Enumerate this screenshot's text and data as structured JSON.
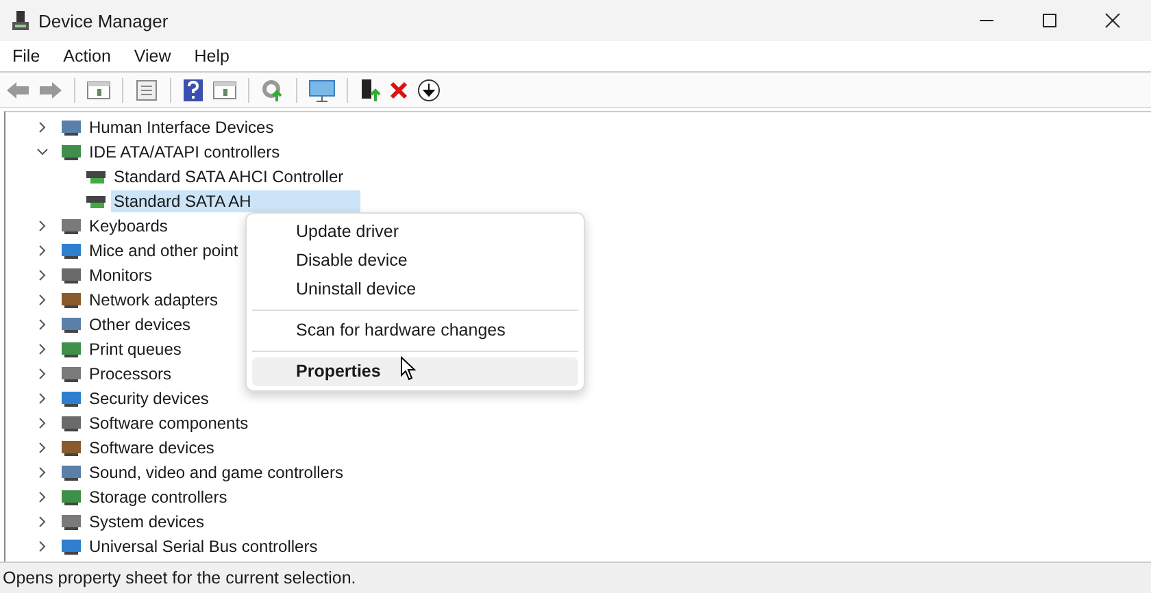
{
  "window": {
    "title": "Device Manager"
  },
  "menu_bar": [
    "File",
    "Action",
    "View",
    "Help"
  ],
  "tree": [
    {
      "label": "Human Interface Devices",
      "expanded": false
    },
    {
      "label": "IDE ATA/ATAPI controllers",
      "expanded": true,
      "children": [
        {
          "label": "Standard SATA AHCI Controller",
          "selected": false
        },
        {
          "label": "Standard SATA AH",
          "selected": true
        }
      ]
    },
    {
      "label": "Keyboards",
      "expanded": false
    },
    {
      "label": "Mice and other point",
      "expanded": false
    },
    {
      "label": "Monitors",
      "expanded": false
    },
    {
      "label": "Network adapters",
      "expanded": false
    },
    {
      "label": "Other devices",
      "expanded": false
    },
    {
      "label": "Print queues",
      "expanded": false
    },
    {
      "label": "Processors",
      "expanded": false
    },
    {
      "label": "Security devices",
      "expanded": false
    },
    {
      "label": "Software components",
      "expanded": false
    },
    {
      "label": "Software devices",
      "expanded": false
    },
    {
      "label": "Sound, video and game controllers",
      "expanded": false
    },
    {
      "label": "Storage controllers",
      "expanded": false
    },
    {
      "label": "System devices",
      "expanded": false
    },
    {
      "label": "Universal Serial Bus controllers",
      "expanded": false
    }
  ],
  "context_menu": {
    "groups": [
      [
        {
          "label": "Update driver",
          "selected": false
        },
        {
          "label": "Disable device",
          "selected": false
        },
        {
          "label": "Uninstall device",
          "selected": false
        }
      ],
      [
        {
          "label": "Scan for hardware changes",
          "selected": false
        }
      ],
      [
        {
          "label": "Properties",
          "selected": true
        }
      ]
    ]
  },
  "status_bar": "Opens property sheet for the current selection."
}
